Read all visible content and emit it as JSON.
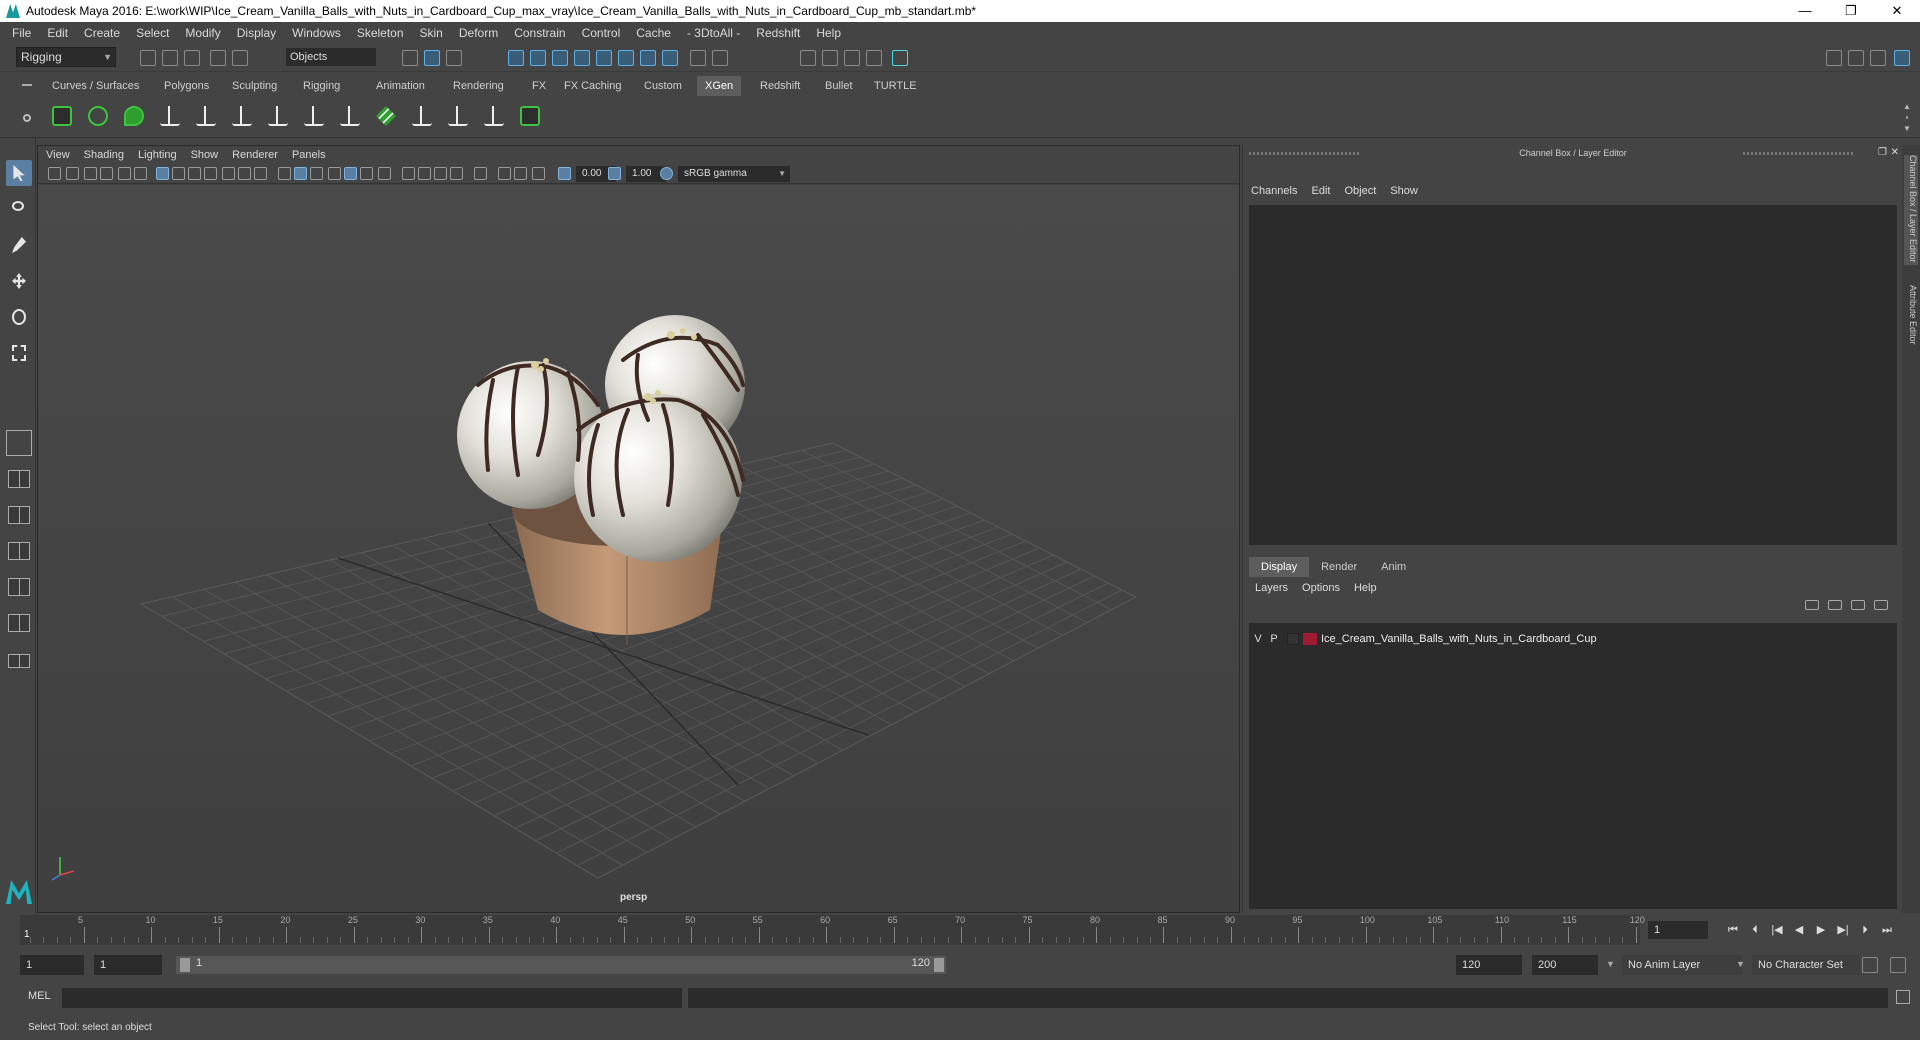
{
  "window": {
    "title": "Autodesk Maya 2016: E:\\work\\WIP\\Ice_Cream_Vanilla_Balls_with_Nuts_in_Cardboard_Cup_max_vray\\Ice_Cream_Vanilla_Balls_with_Nuts_in_Cardboard_Cup_mb_standart.mb*",
    "controls": [
      "—",
      "❐",
      "✕"
    ]
  },
  "menubar": [
    "File",
    "Edit",
    "Create",
    "Select",
    "Modify",
    "Display",
    "Windows",
    "Skeleton",
    "Skin",
    "Deform",
    "Constrain",
    "Control",
    "Cache",
    "- 3DtoAll -",
    "Redshift",
    "Help"
  ],
  "statusline": {
    "mode": "Rigging",
    "selection_field": "Objects"
  },
  "shelf_tabs": [
    {
      "label": "Curves / Surfaces"
    },
    {
      "label": "Polygons"
    },
    {
      "label": "Sculpting"
    },
    {
      "label": "Rigging"
    },
    {
      "label": "Animation"
    },
    {
      "label": "Rendering"
    },
    {
      "label": "FX"
    },
    {
      "label": "FX Caching"
    },
    {
      "label": "Custom"
    },
    {
      "label": "XGen",
      "active": true
    },
    {
      "label": "Redshift"
    },
    {
      "label": "Bullet"
    },
    {
      "label": "TURTLE"
    }
  ],
  "shelf_icons": [
    "xgen-create-icon",
    "xgen-preview-icon",
    "xgen-primitives-icon",
    "xgen-comb-icon",
    "xgen-place-guide-icon",
    "xgen-add-guide-icon",
    "xgen-select-guide-icon",
    "xgen-lock-icon",
    "xgen-guide-sculpt-icon",
    "xgen-layers-icon",
    "xgen-grab-icon",
    "xgen-cut-icon",
    "xgen-length-icon",
    "xgen-toggle-icon"
  ],
  "toolbox": [
    "select-tool-icon",
    "lasso-tool-icon",
    "paint-select-icon",
    "move-tool-icon",
    "rotate-tool-icon",
    "scale-tool-icon"
  ],
  "viewport": {
    "menu": [
      "View",
      "Shading",
      "Lighting",
      "Show",
      "Renderer",
      "Panels"
    ],
    "exposure": "0.00",
    "gamma": "1.00",
    "colorspace": "sRGB gamma",
    "camera_label": "persp"
  },
  "right_panel": {
    "title": "Channel Box / Layer Editor",
    "channel_menu": [
      "Channels",
      "Edit",
      "Object",
      "Show"
    ],
    "layer_tabs": [
      {
        "label": "Display",
        "active": true
      },
      {
        "label": "Render"
      },
      {
        "label": "Anim"
      }
    ],
    "layer_menu": [
      "Layers",
      "Options",
      "Help"
    ],
    "layers": [
      {
        "v": "V",
        "p": "P",
        "color": "#9e1b32",
        "name": "Ice_Cream_Vanilla_Balls_with_Nuts_in_Cardboard_Cup"
      }
    ],
    "side_tabs": [
      "Channel Box / Layer Editor",
      "Attribute Editor"
    ]
  },
  "timeline": {
    "labels": [
      "5",
      "10",
      "15",
      "20",
      "25",
      "30",
      "35",
      "40",
      "45",
      "50",
      "55",
      "60",
      "65",
      "70",
      "75",
      "80",
      "85",
      "90",
      "95",
      "100",
      "105",
      "110",
      "115",
      "120"
    ],
    "current_frame": "1",
    "current_frame_field": "1"
  },
  "range": {
    "start": "1",
    "range_start": "1",
    "slider_start_label": "1",
    "slider_end_label": "120",
    "range_end": "120",
    "end": "200",
    "anim_layer": "No Anim Layer",
    "character_set": "No Character Set"
  },
  "commandline": {
    "label": "MEL"
  },
  "helpline": {
    "text": "Select Tool: select an object"
  }
}
